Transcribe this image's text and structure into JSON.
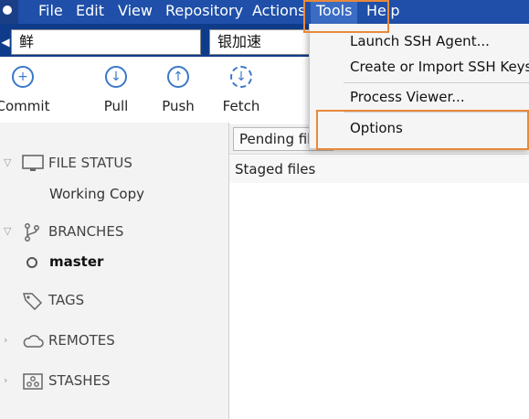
{
  "menubar": {
    "items": [
      "File",
      "Edit",
      "View",
      "Repository",
      "Actions",
      "Tools",
      "Help"
    ],
    "mnemonic_first": [
      "F",
      "E",
      "V",
      "R",
      "A",
      "T",
      "H"
    ]
  },
  "tabs": [
    {
      "label": "鲜"
    },
    {
      "label": "银加速"
    }
  ],
  "toolbar": {
    "commit": "Commit",
    "pull": "Pull",
    "push": "Push",
    "fetch": "Fetch"
  },
  "sidebar": {
    "file_status": "FILE STATUS",
    "working_copy": "Working Copy",
    "branches": "BRANCHES",
    "master": "master",
    "tags": "TAGS",
    "remotes": "REMOTES",
    "stashes": "STASHES"
  },
  "main": {
    "pending_button": "Pending files, sorted by path",
    "staged_files": "Staged files"
  },
  "tools_menu": {
    "items": [
      "Launch SSH Agent...",
      "Create or Import SSH Keys",
      "Process Viewer...",
      "Options"
    ]
  },
  "colors": {
    "menubar_bg": "#1f4fa8",
    "tab_strip_bg": "#0f3c8a",
    "accent_blue": "#3b78c9",
    "highlight": "#e8893a"
  }
}
